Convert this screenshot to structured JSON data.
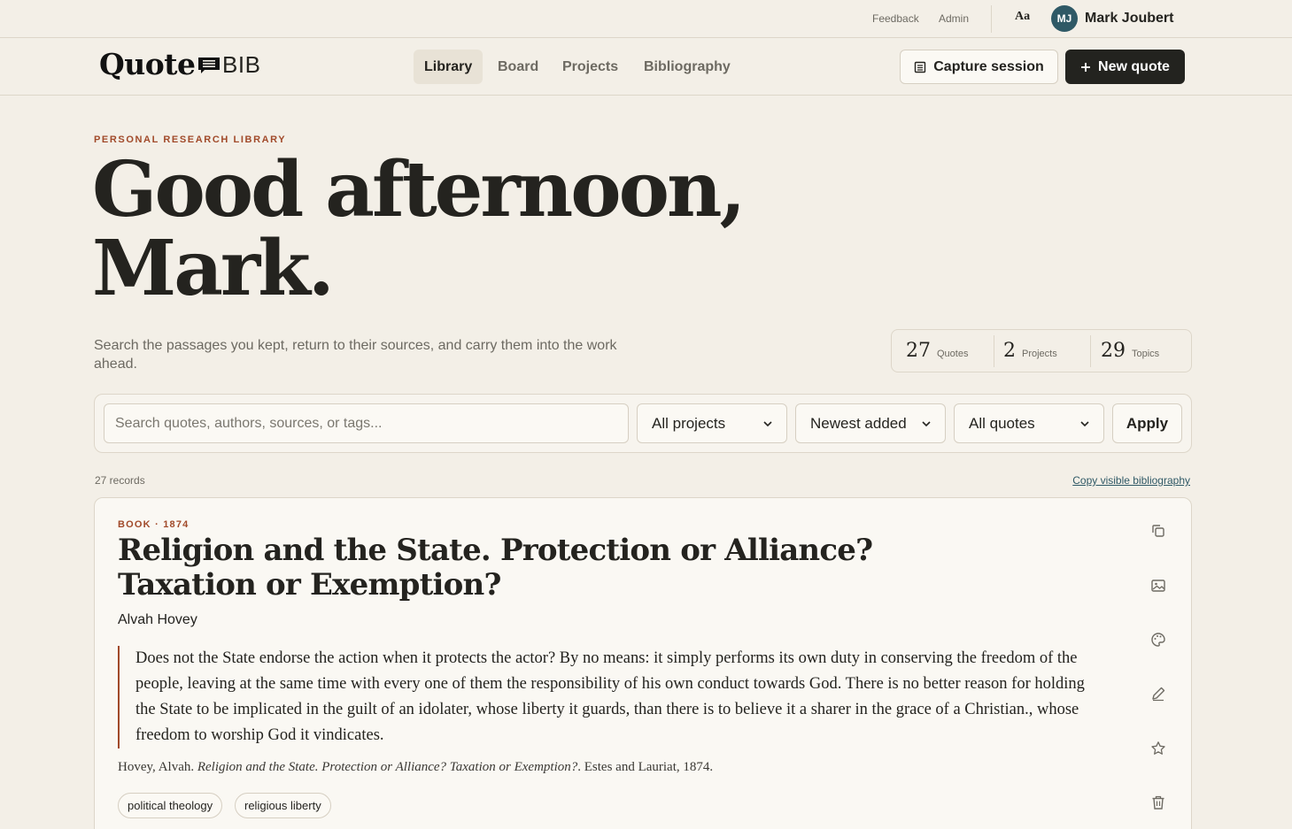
{
  "utility": {
    "feedback": "Feedback",
    "admin": "Admin",
    "font_toggle": "Aa",
    "avatar_initials": "MJ",
    "user_name": "Mark Joubert"
  },
  "header": {
    "logo_quote": "Quote",
    "logo_bib": "BIB",
    "nav": [
      {
        "label": "Library",
        "active": true
      },
      {
        "label": "Board",
        "active": false
      },
      {
        "label": "Projects",
        "active": false
      },
      {
        "label": "Bibliography",
        "active": false
      }
    ],
    "capture_label": "Capture session",
    "new_quote_label": "New quote"
  },
  "hero": {
    "eyebrow": "PERSONAL RESEARCH LIBRARY",
    "greeting_line1": "Good afternoon,",
    "greeting_line2": "Mark.",
    "intro": "Search the passages you kept, return to their sources, and carry them into the work ahead."
  },
  "stats": [
    {
      "value": "27",
      "label": "Quotes"
    },
    {
      "value": "2",
      "label": "Projects"
    },
    {
      "value": "29",
      "label": "Topics"
    }
  ],
  "search": {
    "placeholder": "Search quotes, authors, sources, or tags...",
    "project_filter": "All projects",
    "sort": "Newest added",
    "quote_filter": "All quotes",
    "apply_label": "Apply"
  },
  "results": {
    "count": "27 records",
    "copy_bibliography": "Copy visible bibliography"
  },
  "quote": {
    "type": "BOOK",
    "year": "· 1874",
    "title": "Religion and the State. Protection or Alliance? Taxation or Exemption?",
    "author": "Alvah Hovey",
    "text": "Does not the State endorse the action when it protects the actor? By no means: it simply performs its own duty in conserving the freedom of the people, leaving at the same time with every one of them the responsibility of his own conduct towards God. There is no better reason for holding the State to be implicated in the guilt of an idolater, whose liberty it guards, than there is to believe it a sharer in the grace of a Christian., whose freedom to worship God it vindicates.",
    "citation_prefix": "Hovey, Alvah. ",
    "citation_title": "Religion and the State. Protection or Alliance? Taxation or Exemption?",
    "citation_suffix": ". Estes and Lauriat, 1874.",
    "tags": [
      "political theology",
      "religious liberty"
    ],
    "actions": [
      "copy-icon",
      "image-icon",
      "palette-icon",
      "pencil-icon",
      "star-icon",
      "trash-icon"
    ]
  },
  "colors": {
    "background": "#f3efe7",
    "accent": "#a14a2a",
    "primary_button": "#23231f",
    "avatar": "#2f5966"
  }
}
